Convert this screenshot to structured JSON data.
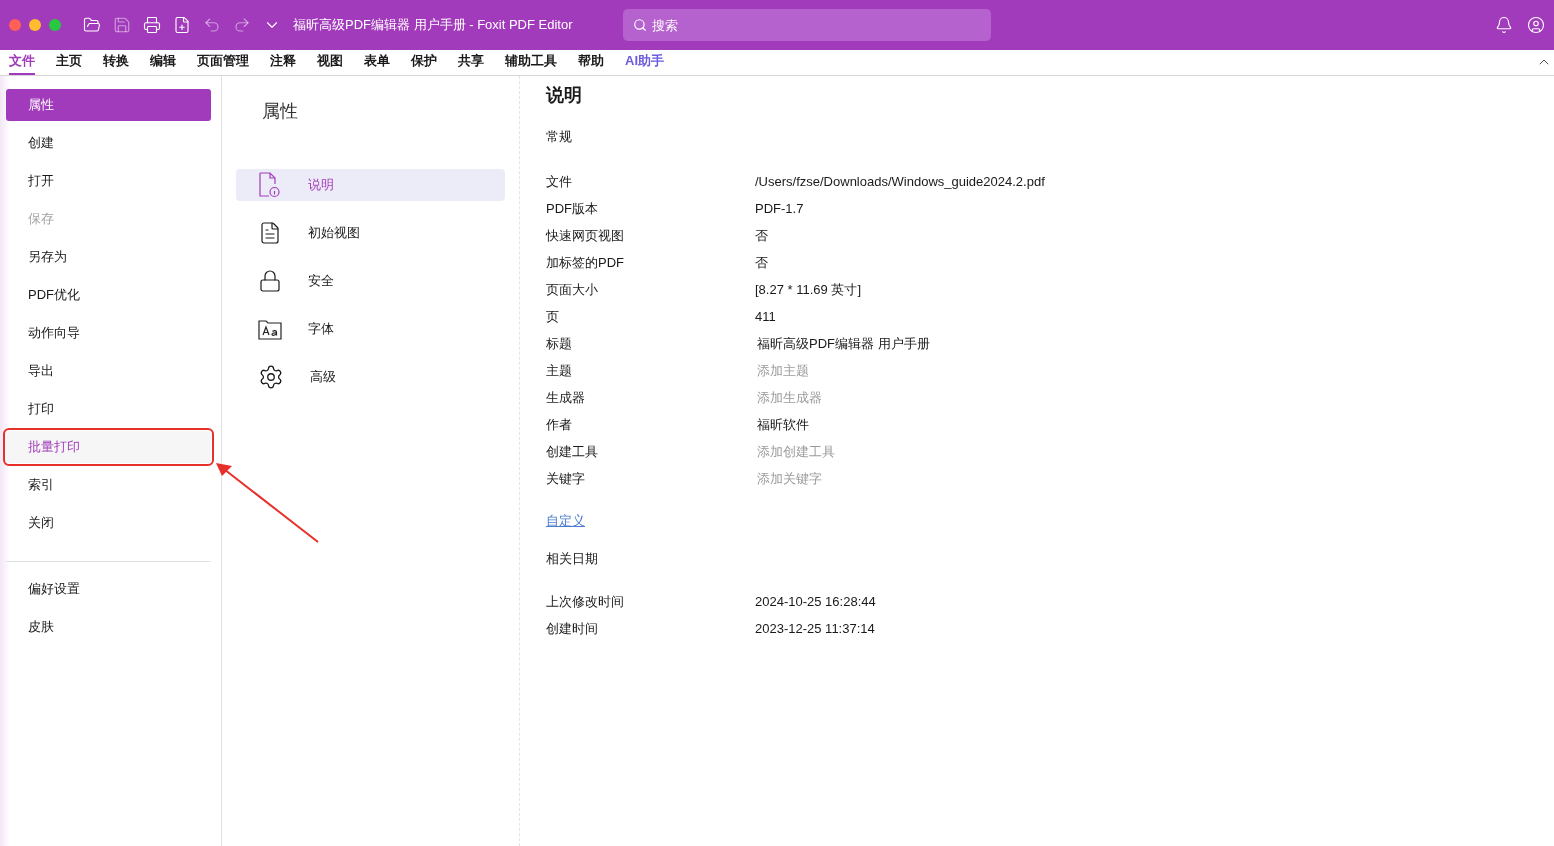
{
  "window": {
    "title": "福昕高级PDF编辑器 用户手册 - Foxit PDF Editor"
  },
  "search": {
    "placeholder": "搜索"
  },
  "tabs": [
    {
      "label": "文件",
      "selected": true,
      "accent": false
    },
    {
      "label": "主页",
      "selected": false,
      "accent": false
    },
    {
      "label": "转换",
      "selected": false,
      "accent": false
    },
    {
      "label": "编辑",
      "selected": false,
      "accent": false
    },
    {
      "label": "页面管理",
      "selected": false,
      "accent": false
    },
    {
      "label": "注释",
      "selected": false,
      "accent": false
    },
    {
      "label": "视图",
      "selected": false,
      "accent": false
    },
    {
      "label": "表单",
      "selected": false,
      "accent": false
    },
    {
      "label": "保护",
      "selected": false,
      "accent": false
    },
    {
      "label": "共享",
      "selected": false,
      "accent": false
    },
    {
      "label": "辅助工具",
      "selected": false,
      "accent": false
    },
    {
      "label": "帮助",
      "selected": false,
      "accent": false
    },
    {
      "label": "AI助手",
      "selected": false,
      "accent": true
    }
  ],
  "sidebar": {
    "groups": [
      [
        {
          "label": "属性",
          "selected": true,
          "disabled": false,
          "annotated": false
        },
        {
          "label": "创建",
          "selected": false,
          "disabled": false,
          "annotated": false
        },
        {
          "label": "打开",
          "selected": false,
          "disabled": false,
          "annotated": false
        },
        {
          "label": "保存",
          "selected": false,
          "disabled": true,
          "annotated": false
        },
        {
          "label": "另存为",
          "selected": false,
          "disabled": false,
          "annotated": false
        },
        {
          "label": "PDF优化",
          "selected": false,
          "disabled": false,
          "annotated": false
        },
        {
          "label": "动作向导",
          "selected": false,
          "disabled": false,
          "annotated": false
        },
        {
          "label": "导出",
          "selected": false,
          "disabled": false,
          "annotated": false
        },
        {
          "label": "打印",
          "selected": false,
          "disabled": false,
          "annotated": false
        },
        {
          "label": "批量打印",
          "selected": false,
          "disabled": false,
          "annotated": true
        },
        {
          "label": "索引",
          "selected": false,
          "disabled": false,
          "annotated": false
        },
        {
          "label": "关闭",
          "selected": false,
          "disabled": false,
          "annotated": false
        }
      ],
      [
        {
          "label": "偏好设置",
          "selected": false,
          "disabled": false,
          "annotated": false
        },
        {
          "label": "皮肤",
          "selected": false,
          "disabled": false,
          "annotated": false
        }
      ]
    ]
  },
  "properties_panel": {
    "title": "属性",
    "items": [
      {
        "label": "说明",
        "kind": "info",
        "selected": true
      },
      {
        "label": "初始视图",
        "kind": "view",
        "selected": false
      },
      {
        "label": "安全",
        "kind": "lock",
        "selected": false
      },
      {
        "label": "字体",
        "kind": "font",
        "selected": false
      },
      {
        "label": "高级",
        "kind": "gear",
        "selected": false
      }
    ]
  },
  "details": {
    "title": "说明",
    "general_heading": "常规",
    "rows": [
      {
        "label": "文件",
        "kind": "text",
        "value": "/Users/fzse/Downloads/Windows_guide2024.2.pdf"
      },
      {
        "label": "PDF版本",
        "kind": "text",
        "value": "PDF-1.7"
      },
      {
        "label": "快速网页视图",
        "kind": "text",
        "value": "否"
      },
      {
        "label": "加标签的PDF",
        "kind": "text",
        "value": "否"
      },
      {
        "label": "页面大小",
        "kind": "text",
        "value": "[8.27 * 11.69 英寸]"
      },
      {
        "label": "页",
        "kind": "text",
        "value": "411"
      },
      {
        "label": "标题",
        "kind": "field",
        "value": "福昕高级PDF编辑器 用户手册"
      },
      {
        "label": "主题",
        "kind": "field",
        "placeholder": "添加主题"
      },
      {
        "label": "生成器",
        "kind": "field",
        "placeholder": "添加生成器"
      },
      {
        "label": "作者",
        "kind": "field",
        "value": "福昕软件"
      },
      {
        "label": "创建工具",
        "kind": "field",
        "placeholder": "添加创建工具"
      },
      {
        "label": "关键字",
        "kind": "field",
        "placeholder": "添加关键字"
      }
    ],
    "custom_link": "自定义",
    "dates_heading": "相关日期",
    "date_rows": [
      {
        "label": "上次修改时间",
        "value": "2024-10-25 16:28:44"
      },
      {
        "label": "创建时间",
        "value": "2023-12-25 11:37:14"
      }
    ]
  }
}
